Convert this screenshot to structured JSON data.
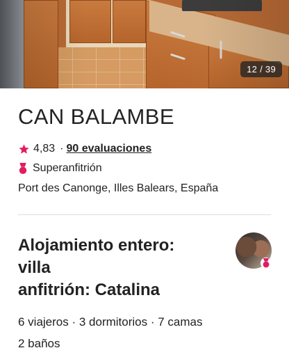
{
  "gallery": {
    "counter": "12 / 39"
  },
  "listing": {
    "title": "CAN BALAMBE",
    "rating": "4,83",
    "separator": "·",
    "reviews_label": "90 evaluaciones",
    "superhost_label": "Superanfitrión",
    "location": "Port des Canonge, Illes Balears, España"
  },
  "host": {
    "title_line1": "Alojamiento entero:",
    "title_line2": "villa",
    "title_line3": "anfitrión: Catalina"
  },
  "details": {
    "line1": "6 viajeros · 3 dormitorios · 7 camas",
    "line2": "2 baños"
  },
  "colors": {
    "brand_pink": "#e31c5f",
    "text": "#222222",
    "divider": "#dddddd"
  },
  "icons": {
    "star": "star-icon",
    "superhost": "medal-icon",
    "verified": "superhost-badge-icon"
  }
}
